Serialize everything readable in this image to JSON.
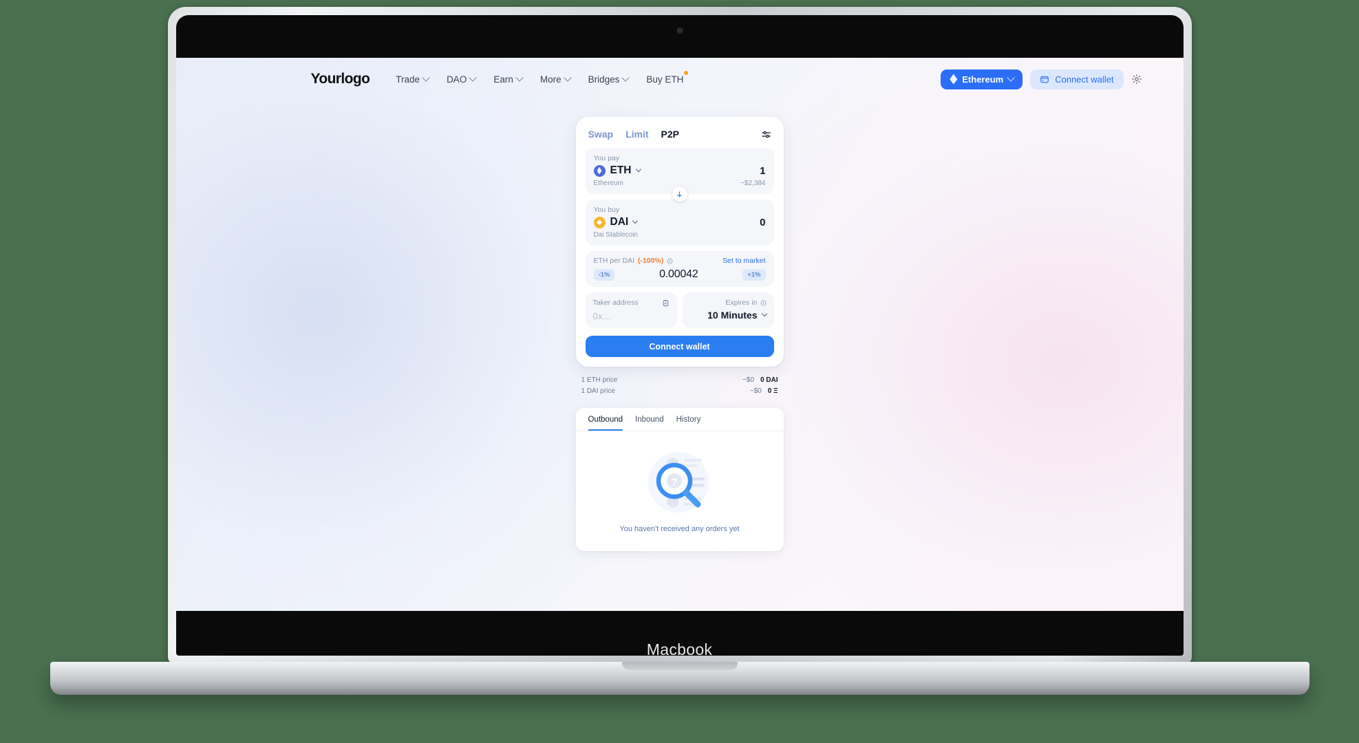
{
  "device": {
    "label": "Macbook"
  },
  "nav": {
    "logo": "Yourlogo",
    "links": [
      {
        "label": "Trade",
        "caret": true,
        "badge": false
      },
      {
        "label": "DAO",
        "caret": true,
        "badge": false
      },
      {
        "label": "Earn",
        "caret": true,
        "badge": false
      },
      {
        "label": "More",
        "caret": true,
        "badge": false
      },
      {
        "label": "Bridges",
        "caret": true,
        "badge": false
      },
      {
        "label": "Buy ETH",
        "caret": false,
        "badge": true
      }
    ],
    "chain": {
      "label": "Ethereum",
      "icon": "ethereum-diamond-icon"
    },
    "connect_wallet": {
      "label": "Connect wallet",
      "icon": "wallet-icon"
    },
    "settings": {
      "icon": "gear-icon"
    }
  },
  "swap_card": {
    "tabs": [
      {
        "label": "Swap",
        "active": false
      },
      {
        "label": "Limit",
        "active": false
      },
      {
        "label": "P2P",
        "active": true
      }
    ],
    "settings_icon": "sliders-icon",
    "pay": {
      "label": "You pay",
      "token_symbol": "ETH",
      "token_icon": "ethereum-token-icon",
      "amount": "1",
      "token_name": "Ethereum",
      "fiat": "~$2,384"
    },
    "switch_icon": "arrow-down-icon",
    "buy": {
      "label": "You buy",
      "token_symbol": "DAI",
      "token_icon": "dai-token-icon",
      "amount": "0",
      "token_name": "Dai Stablecoin",
      "fiat": ""
    },
    "rate": {
      "label": "ETH per DAI",
      "change": "(-100%)",
      "info_icon": "info-icon",
      "set_to_market": "Set to market",
      "minus_label": "-1%",
      "plus_label": "+1%",
      "value": "0.00042"
    },
    "taker": {
      "label": "Taker address",
      "paste_icon": "paste-icon",
      "placeholder": "0x..."
    },
    "expires": {
      "label": "Expires in",
      "info_icon": "info-icon",
      "value": "10 Minutes"
    },
    "cta": {
      "label": "Connect wallet"
    }
  },
  "prices": [
    {
      "label": "1 ETH price",
      "usd": "~$0",
      "token": "0 DAI"
    },
    {
      "label": "1 DAI price",
      "usd": "~$0",
      "token": "0 Ξ"
    }
  ],
  "orders": {
    "tabs": [
      {
        "label": "Outbound",
        "active": true
      },
      {
        "label": "Inbound",
        "active": false
      },
      {
        "label": "History",
        "active": false
      }
    ],
    "empty_illustration": "magnifier-question-icon",
    "empty_text": "You haven't received any orders yet"
  },
  "colors": {
    "page_background": "#4a7050",
    "accent_blue": "#2b7ef0",
    "chain_blue": "#2b6ef5",
    "soft_blue": "#dbe7fd",
    "warn_orange": "#ef7f2e",
    "dai_gold": "#f4b731",
    "text_dark": "#101828",
    "text_muted": "#8a97ac"
  }
}
